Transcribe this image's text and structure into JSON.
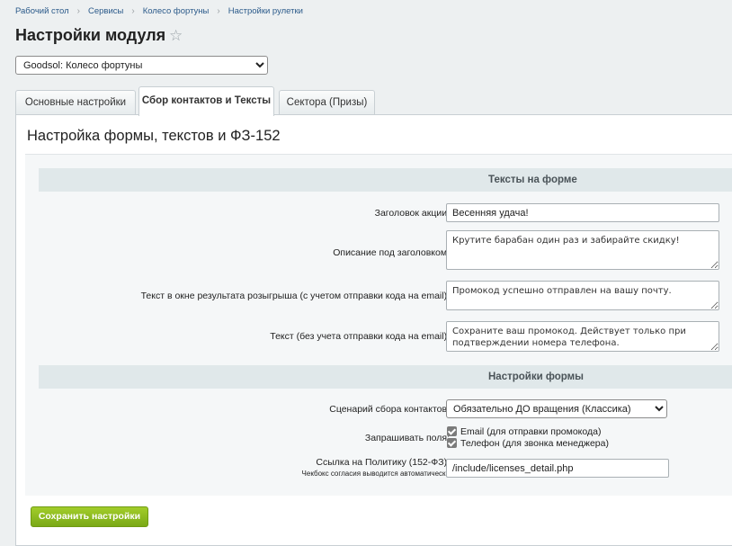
{
  "breadcrumb": [
    "Рабочий стол",
    "Сервисы",
    "Колесо фортуны",
    "Настройки рулетки"
  ],
  "breadcrumb_separator": "›",
  "page": {
    "title": "Настройки модуля"
  },
  "module_select": {
    "value": "Goodsol: Колесо фортуны"
  },
  "tabs": [
    {
      "label": "Основные настройки"
    },
    {
      "label": "Сбор контактов и Тексты"
    },
    {
      "label": "Сектора (Призы)"
    }
  ],
  "panel": {
    "title": "Настройка формы, текстов и ФЗ-152"
  },
  "texts_section": {
    "header": "Тексты на форме",
    "promo_title": {
      "label": "Заголовок акции:",
      "value": "Весенняя удача!"
    },
    "description": {
      "label": "Описание под заголовком:",
      "value": "Крутите барабан один раз и забирайте скидку!"
    },
    "result_email": {
      "label": "Текст в окне результата розыгрыша (с учетом отправки кода на email):",
      "value": "Промокод успешно отправлен на вашу почту."
    },
    "result_no_email": {
      "label": "Текст (без учета отправки кода на email):",
      "value": "Сохраните ваш промокод. Действует только при подтверждении номера телефона."
    }
  },
  "form_section": {
    "header": "Настройки формы",
    "scenario": {
      "label": "Сценарий сбора контактов:",
      "value": "Обязательно ДО вращения (Классика)"
    },
    "fields": {
      "label": "Запрашивать поля:",
      "options": [
        {
          "label": "Email (для отправки промокода)",
          "checked": true
        },
        {
          "label": "Телефон (для звонка менеджера)",
          "checked": true
        }
      ]
    },
    "policy": {
      "label": "Ссылка на Политику (152-ФЗ):",
      "sublabel": "Чекбокс согласия выводится автоматически",
      "value": "/include/licenses_detail.php"
    }
  },
  "actions": {
    "save_label": "Сохранить настройки"
  },
  "colors": {
    "accent": "#8dbc1f",
    "header_bg": "#e0e8ea",
    "page_bg": "#edf0f1"
  }
}
